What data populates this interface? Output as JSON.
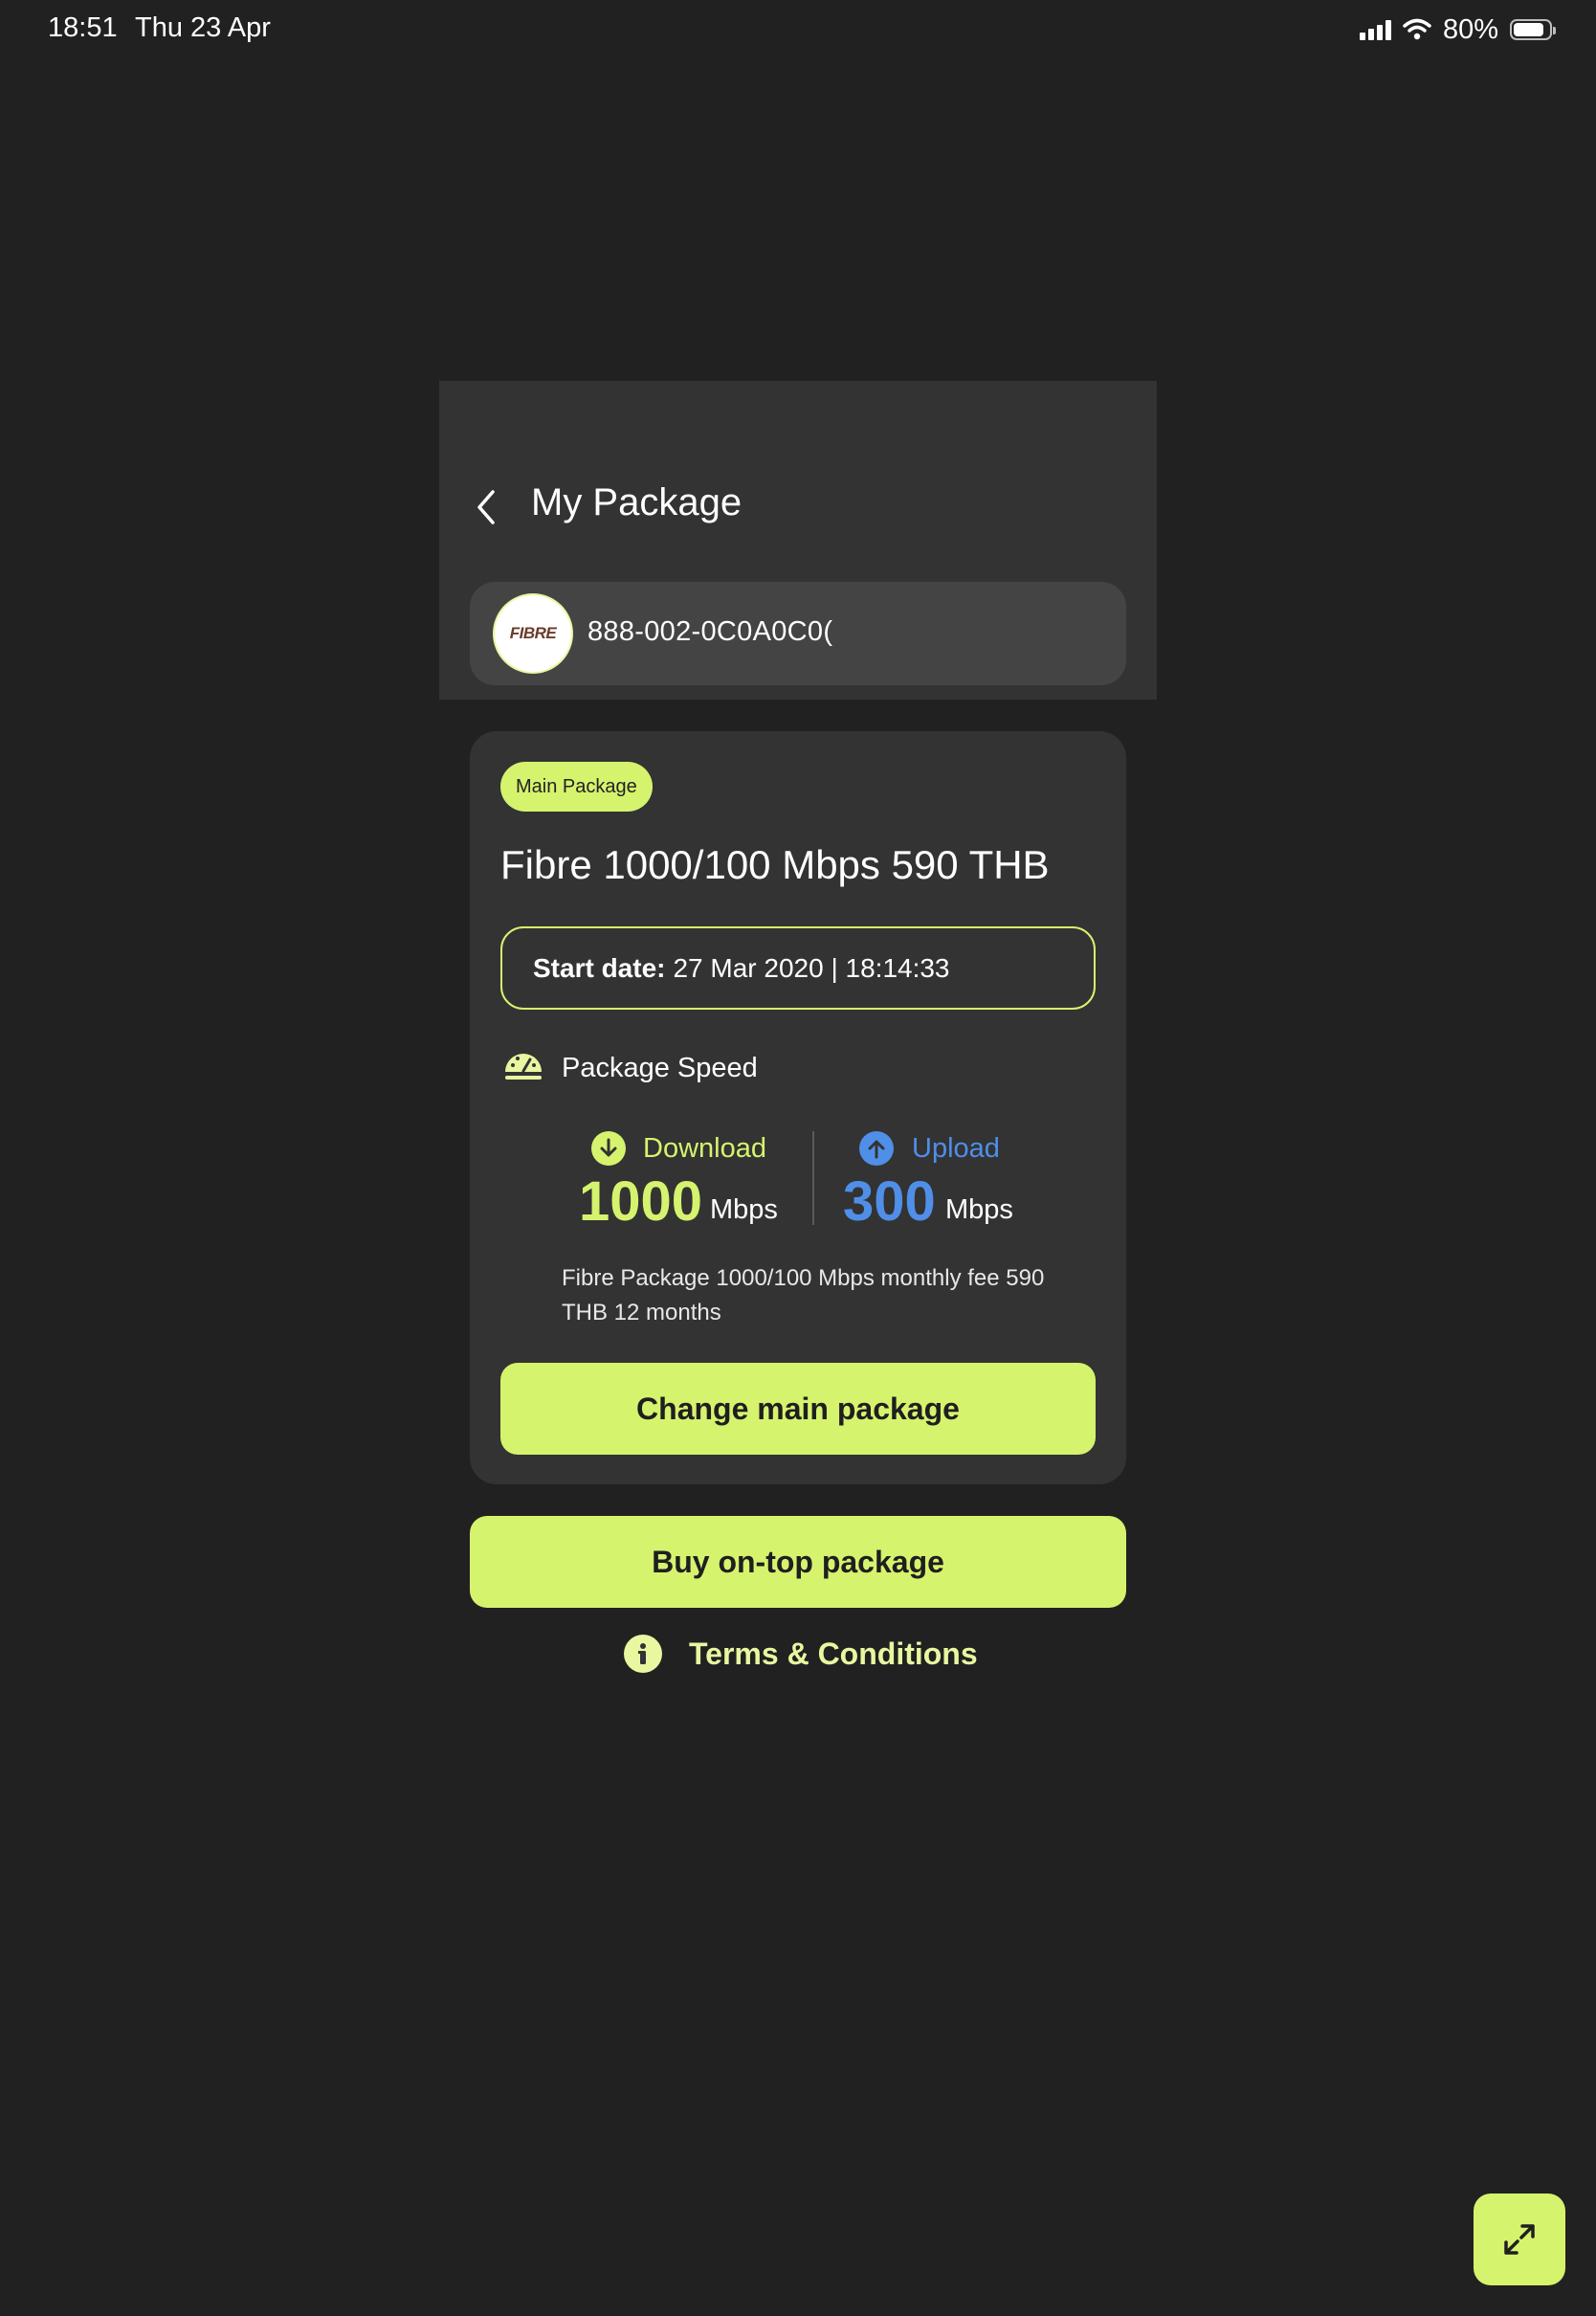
{
  "status_bar": {
    "time": "18:51",
    "date": "Thu 23 Apr",
    "battery_percent": "80%",
    "battery_level": 0.8,
    "icons": [
      "cellular-signal-icon",
      "wifi-icon",
      "battery-icon"
    ]
  },
  "header": {
    "title": "My Package",
    "back_icon": "chevron-left-icon"
  },
  "account": {
    "logo_text": "FIBRE",
    "number": "888-002-0C0A0C0("
  },
  "package": {
    "badge": "Main Package",
    "name": "Fibre 1000/100 Mbps 590 THB",
    "start_label": "Start date:",
    "start_value": "27 Mar 2020 | 18:14:33",
    "speed_title": "Package Speed",
    "speed_icon": "speedometer-icon",
    "download": {
      "label": "Download",
      "value": "1000",
      "unit": "Mbps",
      "icon": "arrow-down-circle-icon"
    },
    "upload": {
      "label": "Upload",
      "value": "300",
      "unit": "Mbps",
      "icon": "arrow-up-circle-icon"
    },
    "description": "Fibre Package 1000/100 Mbps monthly fee 590 THB 12 months",
    "change_button": "Change main package"
  },
  "actions": {
    "ontop_button": "Buy on-top package",
    "terms_label": "Terms & Conditions",
    "terms_icon": "info-icon",
    "expand_icon": "expand-icon"
  },
  "colors": {
    "background": "#212121",
    "panel": "#333333",
    "accent": "#d6f36e",
    "upload_blue": "#4f8fe8"
  }
}
